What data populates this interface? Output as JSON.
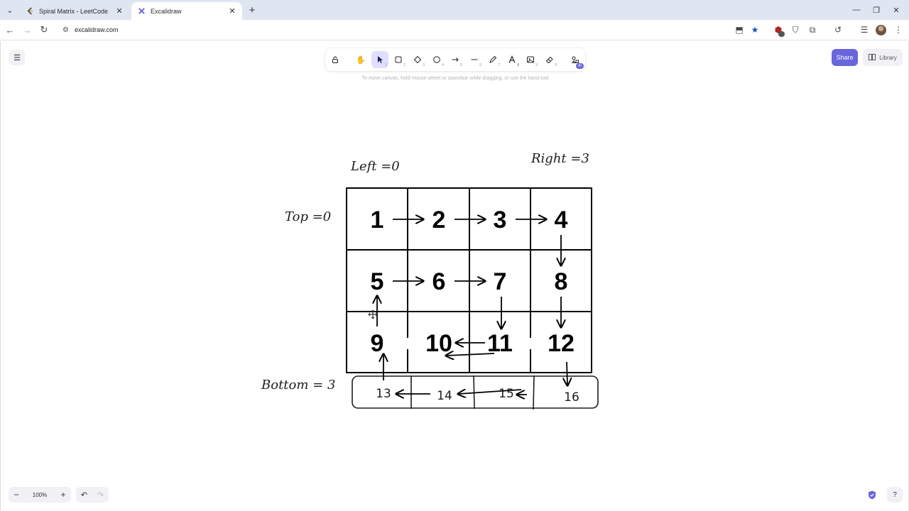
{
  "browser": {
    "tabs": [
      {
        "title": "Spiral Matrix - LeetCode",
        "active": false
      },
      {
        "title": "Excalidraw",
        "active": true
      }
    ],
    "url": "excalidraw.com"
  },
  "toolbar": {
    "tools": [
      {
        "name": "lock",
        "icon": "lock-icon",
        "key": ""
      },
      {
        "name": "hand",
        "icon": "hand-icon",
        "key": ""
      },
      {
        "name": "selection",
        "icon": "pointer-icon",
        "key": "1",
        "selected": true
      },
      {
        "name": "rectangle",
        "icon": "rectangle-icon",
        "key": "2"
      },
      {
        "name": "diamond",
        "icon": "diamond-icon",
        "key": "3"
      },
      {
        "name": "ellipse",
        "icon": "ellipse-icon",
        "key": "4"
      },
      {
        "name": "arrow",
        "icon": "arrow-icon",
        "key": "5"
      },
      {
        "name": "line",
        "icon": "line-icon",
        "key": "6"
      },
      {
        "name": "draw",
        "icon": "pencil-icon",
        "key": "7"
      },
      {
        "name": "text",
        "icon": "text-icon",
        "key": "8"
      },
      {
        "name": "image",
        "icon": "image-icon",
        "key": "9"
      },
      {
        "name": "eraser",
        "icon": "eraser-icon",
        "key": "0"
      },
      {
        "name": "more-tools",
        "icon": "shapes-icon",
        "key": "",
        "badge": "AI"
      }
    ],
    "hint": "To move canvas, hold mouse wheel or spacebar while dragging, or use the hand tool"
  },
  "header": {
    "share_label": "Share",
    "library_label": "Library"
  },
  "footer": {
    "zoom": "100%"
  },
  "drawing": {
    "labels": {
      "left": "Left =0",
      "right": "Right =3",
      "top": "Top =0",
      "bottom": "Bottom = 3"
    },
    "grid_rows": [
      [
        "1",
        "2",
        "3",
        "4"
      ],
      [
        "5",
        "6",
        "7",
        "8"
      ],
      [
        "9",
        "10",
        "11",
        "12"
      ]
    ],
    "bottom_row": [
      "13",
      "14",
      "15",
      "16"
    ]
  },
  "colors": {
    "accent": "#6965db",
    "selected_tool": "#e0dfff",
    "stroke": "#1e1e1e"
  }
}
